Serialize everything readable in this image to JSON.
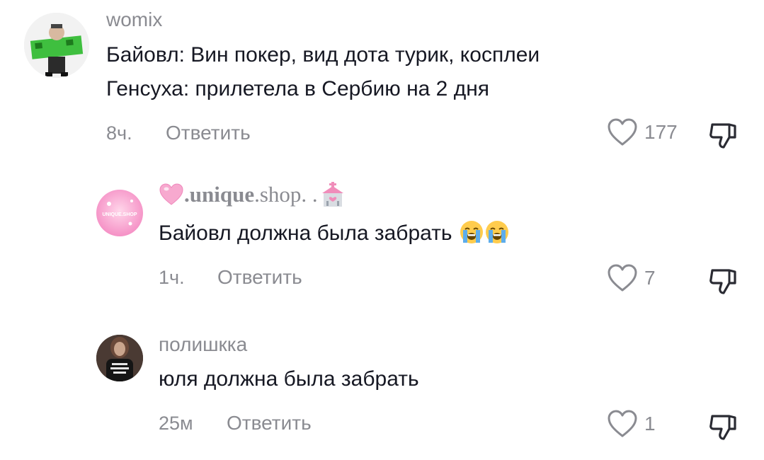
{
  "comments": [
    {
      "username": "womix",
      "lines": [
        "Байовл: Вин покер, вид дота турик, косплеи",
        "Генсуха: прилетела в Сербию на 2 дня"
      ],
      "time": "8ч.",
      "reply_label": "Ответить",
      "likes": "177"
    },
    {
      "username_parts": [
        ".unique",
        ".shop",
        ". ."
      ],
      "lines": [
        "Байовл должна была забрать"
      ],
      "avatar_text": "UNIQUE.SHOP",
      "time": "1ч.",
      "reply_label": "Ответить",
      "likes": "7"
    },
    {
      "username": "полишкка",
      "lines": [
        "юля должна была забрать"
      ],
      "time": "25м",
      "reply_label": "Ответить",
      "likes": "1"
    }
  ],
  "icons": {
    "like": "heart-outline-icon",
    "dislike": "thumbs-down-icon",
    "emoji": "loudly-crying-face-emoji",
    "username_decor": [
      "pink-heart-emoji",
      "wedding-chapel-emoji"
    ]
  },
  "colors": {
    "muted_text": "#8a8b91",
    "primary_text": "#161823",
    "background": "#ffffff"
  }
}
